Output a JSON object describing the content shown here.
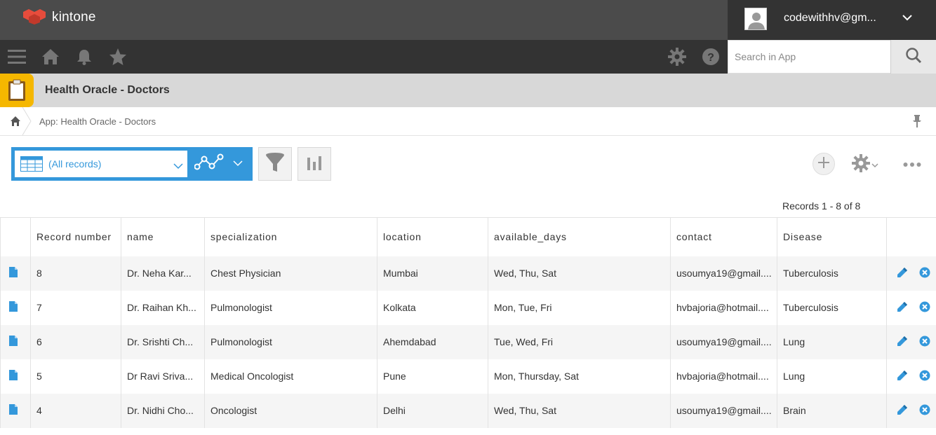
{
  "header": {
    "app_name": "kintone",
    "user_name": "codewithhv@gm...",
    "brand_color": "#e74c3c"
  },
  "nav": {
    "search_placeholder": "Search in App"
  },
  "app": {
    "title": "Health Oracle - Doctors"
  },
  "breadcrumb": {
    "text": "App: Health Oracle - Doctors"
  },
  "toolbar": {
    "view_label": "(All records)",
    "record_count": "Records 1 - 8 of 8",
    "accent_color": "#3498db"
  },
  "table": {
    "columns": [
      "Record number",
      "name",
      "specialization",
      "location",
      "available_days",
      "contact",
      "Disease"
    ],
    "rows": [
      {
        "record_number": "8",
        "name": "Dr. Neha Kar...",
        "specialization": "Chest Physician",
        "location": "Mumbai",
        "available_days": "Wed, Thu, Sat",
        "contact": "usoumya19@gmail....",
        "disease": "Tuberculosis"
      },
      {
        "record_number": "7",
        "name": "Dr. Raihan Kh...",
        "specialization": "Pulmonologist",
        "location": "Kolkata",
        "available_days": "Mon, Tue, Fri",
        "contact": "hvbajoria@hotmail....",
        "disease": "Tuberculosis"
      },
      {
        "record_number": "6",
        "name": "Dr. Srishti Ch...",
        "specialization": "Pulmonologist",
        "location": "Ahemdabad",
        "available_days": "Tue, Wed, Fri",
        "contact": "usoumya19@gmail....",
        "disease": "Lung"
      },
      {
        "record_number": "5",
        "name": "Dr Ravi Sriva...",
        "specialization": "Medical Oncologist",
        "location": "Pune",
        "available_days": "Mon, Thursday, Sat",
        "contact": "hvbajoria@hotmail....",
        "disease": "Lung"
      },
      {
        "record_number": "4",
        "name": "Dr. Nidhi Cho...",
        "specialization": "Oncologist",
        "location": "Delhi",
        "available_days": "Wed, Thu, Sat",
        "contact": "usoumya19@gmail....",
        "disease": "Brain"
      }
    ]
  }
}
